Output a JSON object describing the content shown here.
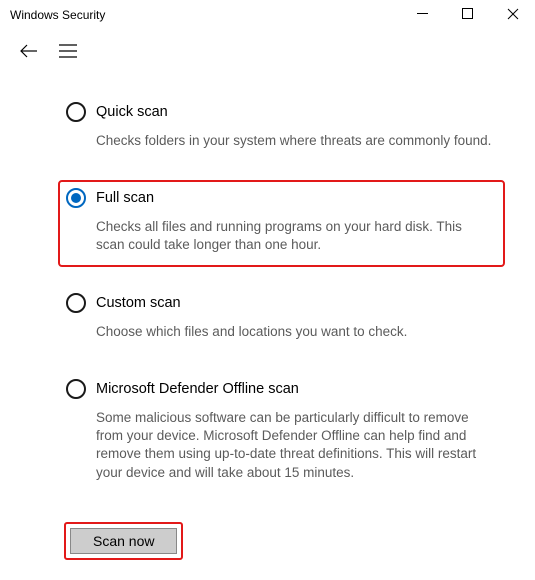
{
  "window": {
    "title": "Windows Security"
  },
  "options": [
    {
      "label": "Quick scan",
      "desc": "Checks folders in your system where threats are commonly found."
    },
    {
      "label": "Full scan",
      "desc": "Checks all files and running programs on your hard disk. This scan could take longer than one hour."
    },
    {
      "label": "Custom scan",
      "desc": "Choose which files and locations you want to check."
    },
    {
      "label": "Microsoft Defender Offline scan",
      "desc": "Some malicious software can be particularly difficult to remove from your device. Microsoft Defender Offline can help find and remove them using up-to-date threat definitions. This will restart your device and will take about 15 minutes."
    }
  ],
  "buttons": {
    "scan_now": "Scan now"
  }
}
